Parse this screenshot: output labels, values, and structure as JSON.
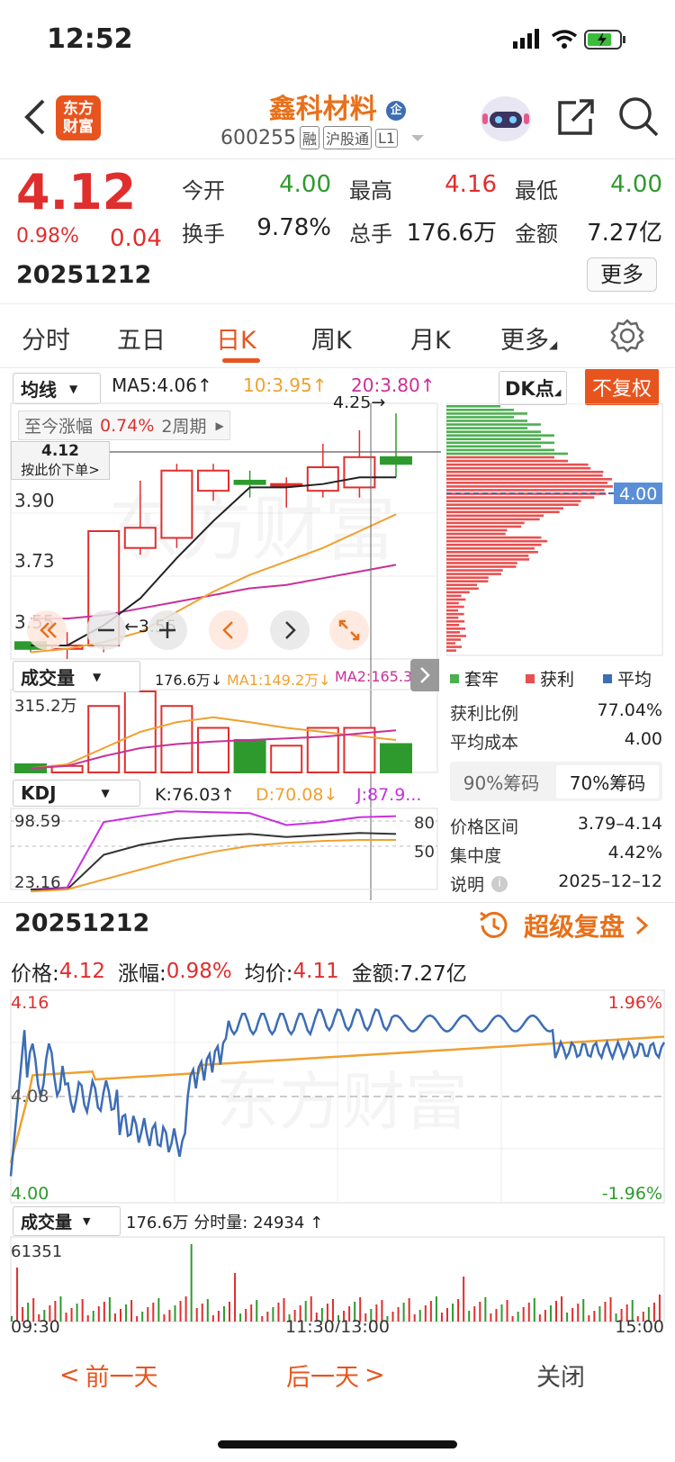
{
  "status_bar": {
    "time": "12:52"
  },
  "header": {
    "logo_line1": "东方",
    "logo_line2": "财富",
    "name": "鑫科材料",
    "name_badge": "企",
    "code": "600255",
    "tags": [
      "融",
      "沪股通",
      "L1"
    ]
  },
  "quote": {
    "price": "4.12",
    "change_pct": "0.98%",
    "change": "0.04",
    "date": "20251212",
    "open_label": "今开",
    "open": "4.00",
    "high_label": "最高",
    "high": "4.16",
    "low_label": "最低",
    "low": "4.00",
    "turnover_label": "换手",
    "turnover": "9.78%",
    "volume_label": "总手",
    "volume": "176.6万",
    "amount_label": "金额",
    "amount": "7.27亿",
    "more": "更多"
  },
  "tabs": [
    "分时",
    "五日",
    "日K",
    "周K",
    "月K",
    "更多"
  ],
  "active_tab": "日K",
  "kline": {
    "indicator": "均线",
    "ma5": "MA5:4.06",
    "ma10": "10:3.95",
    "ma20": "20:3.80",
    "dk_label": "DK点",
    "fuquan": "不复权",
    "since_label": "至今涨幅",
    "since_value": "0.74%",
    "period": "2周期",
    "order_price": "4.12",
    "order_hint": "按此价下单>",
    "y_labels": [
      "3.90",
      "3.73",
      "3.55"
    ],
    "high_marker": "4.25",
    "low_marker": "3.55",
    "watermark": "东方财富"
  },
  "volume": {
    "label": "成交量",
    "value": "176.6万",
    "ma1": "MA1:149.2万",
    "ma2": "MA2:165.3...",
    "max": "315.2万"
  },
  "kdj": {
    "label": "KDJ",
    "k": "K:76.03",
    "d": "D:70.08",
    "j": "J:87.9...",
    "top": "98.59",
    "bottom": "23.16",
    "line80": "80",
    "line50": "50"
  },
  "chip": {
    "price_tag": "4.00",
    "legend": [
      "套牢",
      "获利",
      "平均"
    ],
    "profit_ratio_label": "获利比例",
    "profit_ratio": "77.04%",
    "avg_cost_label": "平均成本",
    "avg_cost": "4.00",
    "tab90": "90%筹码",
    "tab70": "70%筹码",
    "range_label": "价格区间",
    "range": "3.79–4.14",
    "concentration_label": "集中度",
    "concentration": "4.42%",
    "note_label": "说明",
    "note_date": "2025–12–12"
  },
  "intraday": {
    "date": "20251212",
    "replay": "超级复盘",
    "price_label": "价格:",
    "price": "4.12",
    "chg_label": "涨幅:",
    "chg": "0.98%",
    "avg_label": "均价:",
    "avg": "4.11",
    "amount_label": "金额:",
    "amount": "7.27亿",
    "y_top": "4.16",
    "y_mid": "4.08",
    "y_bot": "4.00",
    "pct_top": "1.96%",
    "pct_bot": "-1.96%",
    "vol_label": "成交量",
    "vol": "176.6万",
    "tick_label": "分时量:",
    "tick": "24934",
    "vol_max": "61351",
    "time_start": "09:30",
    "time_mid": "11:30/13:00",
    "time_end": "15:00",
    "watermark": "东方财富"
  },
  "bottom": {
    "prev": "前一天",
    "next": "后一天",
    "close": "关闭"
  },
  "colors": {
    "up": "#e02e2e",
    "down": "#2e9a2e",
    "accent": "#e8541e",
    "avg": "#f0a030",
    "price_line": "#3c6db5"
  }
}
